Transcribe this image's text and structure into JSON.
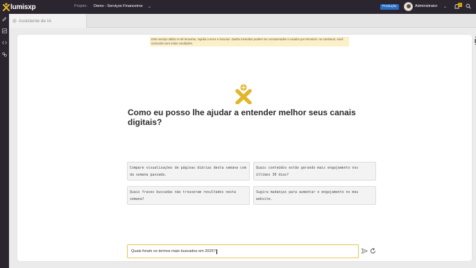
{
  "app": {
    "logo_text": "lumisxp"
  },
  "header": {
    "project_label": "Projeto:",
    "project_value": "Demo - Serviços Financeiros",
    "environment_badge": "Produção",
    "user_name": "Administrator",
    "notification_count": "27"
  },
  "tabs": [
    {
      "label": "Assistente de IA"
    }
  ],
  "sidebar": {
    "icons": [
      "edit-icon",
      "chart-icon",
      "code-icon",
      "link-icon"
    ]
  },
  "assistant": {
    "disclaimer": "Este serviço utiliza IA de terceiros, sujeita a erros e lacunas. Dados inseridos podem ser armazenados e usados por terceiros. Ao continuar, você concorda com estas condições.",
    "headline": "Como eu posso lhe ajudar a entender melhor seus canais digitais?",
    "suggestions": [
      {
        "text": "Compare visualizações de páginas diárias desta semana com da semana passada."
      },
      {
        "text": "Quais conteúdos estão gerando mais engajamento nos últimos 30 dias?"
      },
      {
        "text": "Quais frases buscadas não trouxeram resultados nesta semana?"
      },
      {
        "text": "Sugira mudanças para aumentar o engajamento no meu website."
      }
    ],
    "input_value": "Quais foram os termos mais buscados em 2025?"
  },
  "colors": {
    "brand_yellow": "#e3b52b",
    "dark_chrome": "#2b2530",
    "badge_blue": "#2a6ec4"
  }
}
